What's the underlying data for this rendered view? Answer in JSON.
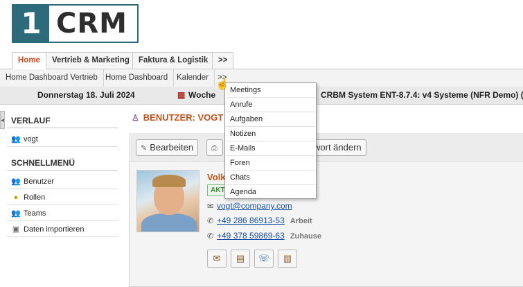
{
  "logo": {
    "number": "1",
    "text": "CRM"
  },
  "main_tabs": [
    {
      "label": "Home"
    },
    {
      "label": "Vertrieb & Marketing"
    },
    {
      "label": "Faktura & Logistik"
    },
    {
      "label": ">>"
    }
  ],
  "sub_tabs": [
    {
      "label": "Home Dashboard Vertrieb"
    },
    {
      "label": "Home Dashboard"
    },
    {
      "label": "Kalender"
    },
    {
      "label": ">>"
    }
  ],
  "datebar": {
    "date": "Donnerstag 18. Juli 2024",
    "week": "Woche",
    "system": "CRBM System ENT-8.7.4: v4 Systeme (NFR Demo) ("
  },
  "sidebar": {
    "history_title": "VERLAUF",
    "history_items": [
      {
        "label": "vogt",
        "icon": "users-icon"
      }
    ],
    "menu_title": "SCHNELLMENÜ",
    "menu_items": [
      {
        "label": "Benutzer",
        "icon": "users-icon"
      },
      {
        "label": "Rollen",
        "icon": "roles-icon"
      },
      {
        "label": "Teams",
        "icon": "teams-icon"
      },
      {
        "label": "Daten importieren",
        "icon": "import-icon"
      }
    ]
  },
  "main": {
    "heading": "BENUTZER: VOGT",
    "toolbar": {
      "edit_label": "Bearbeiten",
      "password_label": "wort ändern"
    },
    "user": {
      "name": "Volk",
      "status": "AKT",
      "email": "vogt@company.com",
      "phone_work": "+49 286 86913-53",
      "phone_work_label": "Arbeit",
      "phone_home": "+49 378 59869-63",
      "phone_home_label": "Zuhause"
    }
  },
  "dropdown": {
    "items": [
      "Meetings",
      "Anrufe",
      "Aufgaben",
      "Notizen",
      "E-Mails",
      "Foren",
      "Chats",
      "Agenda"
    ]
  },
  "colors": {
    "brand": "#2d6a7a",
    "accent": "#c0541c",
    "link": "#1a4fa0"
  }
}
